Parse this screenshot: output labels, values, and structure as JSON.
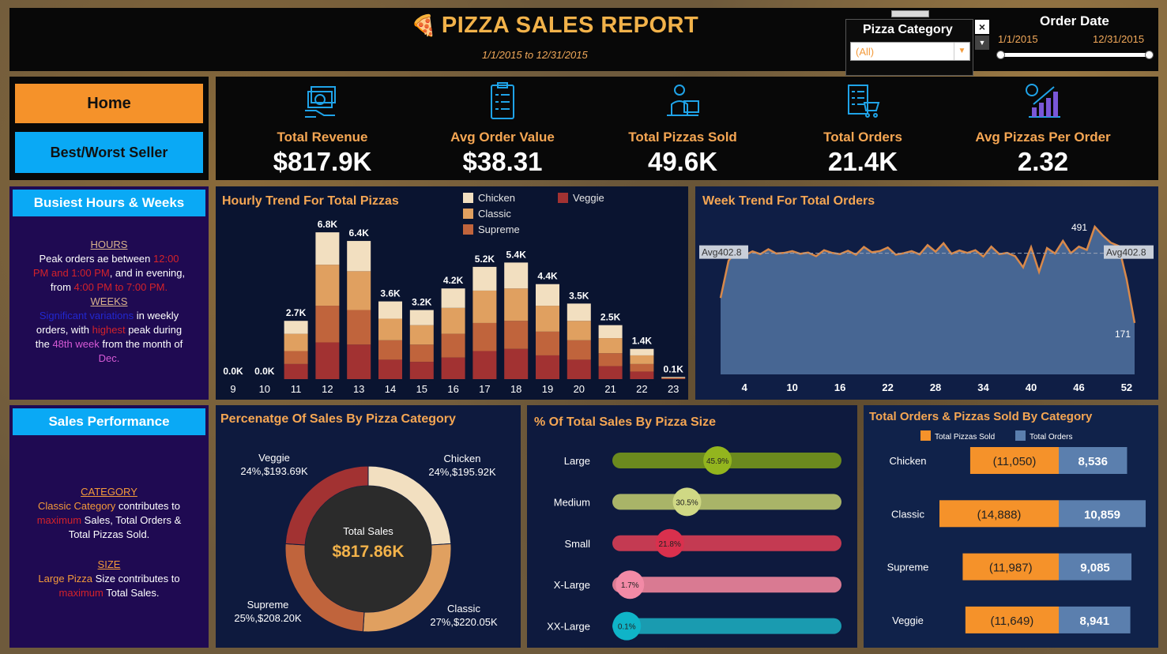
{
  "header": {
    "title": "PIZZA SALES REPORT",
    "subtitle": "1/1/2015 to 12/31/2015",
    "pizza_category_label": "Pizza Category",
    "pizza_category_value": "(All)",
    "order_date_label": "Order Date",
    "order_date_from": "1/1/2015",
    "order_date_to": "12/31/2015"
  },
  "nav": {
    "home": "Home",
    "best_worst": "Best/Worst Seller"
  },
  "kpis": [
    {
      "label": "Total Revenue",
      "value": "$817.9K",
      "icon": "money-icon"
    },
    {
      "label": "Avg Order Value",
      "value": "$38.31",
      "icon": "clipboard-icon"
    },
    {
      "label": "Total Pizzas Sold",
      "value": "49.6K",
      "icon": "delivery-icon"
    },
    {
      "label": "Total Orders",
      "value": "21.4K",
      "icon": "cart-icon"
    },
    {
      "label": "Avg Pizzas Per Order",
      "value": "2.32",
      "icon": "growth-chart-icon"
    }
  ],
  "busiest": {
    "heading": "Busiest Hours & Weeks",
    "hours_title": "HOURS",
    "hours_text_1": "Peak orders ae between ",
    "hours_text_2": "12:00 PM and 1:00 PM",
    "hours_text_3": ", and in evening, from ",
    "hours_text_4": "4:00 PM to 7:00 PM.",
    "weeks_title": "WEEKS",
    "weeks_text_1": "Significant variations",
    "weeks_text_2": " in weekly orders, with ",
    "weeks_text_3": "highest",
    "weeks_text_4": " peak during the ",
    "weeks_text_5": "48th week",
    "weeks_text_6": " from the month of ",
    "weeks_text_7": "Dec."
  },
  "sales_perf": {
    "heading": "Sales Performance",
    "cat_title": "CATEGORY",
    "cat_text_1": "Classic Category",
    "cat_text_2": " contributes to ",
    "cat_text_3": "maximum",
    "cat_text_4": " Sales, Total Orders & Total Pizzas Sold.",
    "size_title": "SIZE",
    "size_text_1": "Large Pizza",
    "size_text_2": " Size contributes to ",
    "size_text_3": "maximum",
    "size_text_4": " Total Sales."
  },
  "chart_titles": {
    "hourly": "Hourly Trend For Total Pizzas",
    "weekly": "Week Trend For Total Orders",
    "donut": "Percenatge Of Sales By Pizza Category",
    "size": "% Of Total Sales By Pizza Size",
    "cat_bars": "Total Orders & Pizzas Sold By Category"
  },
  "colors": {
    "chicken": "#f2dfc0",
    "classic": "#e0a060",
    "supreme": "#c0643c",
    "veggie": "#a23232",
    "accent": "#f5a653",
    "button_home": "#f5922a",
    "button_blue": "#0aa9f5"
  },
  "chart_data": [
    {
      "type": "bar",
      "title": "Hourly Trend For Total Pizzas",
      "stacked": true,
      "categories": [
        "9",
        "10",
        "11",
        "12",
        "13",
        "14",
        "15",
        "16",
        "17",
        "18",
        "19",
        "20",
        "21",
        "22",
        "23"
      ],
      "totals": [
        "0.0K",
        "0.0K",
        "2.7K",
        "6.8K",
        "6.4K",
        "3.6K",
        "3.2K",
        "4.2K",
        "5.2K",
        "5.4K",
        "4.4K",
        "3.5K",
        "2.5K",
        "1.4K",
        "0.1K"
      ],
      "legend": [
        "Chicken",
        "Classic",
        "Supreme",
        "Veggie"
      ],
      "series": [
        {
          "name": "Chicken",
          "values": [
            0,
            0,
            0.6,
            1.5,
            1.4,
            0.8,
            0.7,
            0.9,
            1.1,
            1.2,
            1.0,
            0.8,
            0.6,
            0.3,
            0.03
          ]
        },
        {
          "name": "Classic",
          "values": [
            0,
            0,
            0.8,
            1.9,
            1.8,
            1.0,
            0.9,
            1.2,
            1.5,
            1.5,
            1.2,
            0.9,
            0.7,
            0.4,
            0.03
          ]
        },
        {
          "name": "Supreme",
          "values": [
            0,
            0,
            0.6,
            1.7,
            1.6,
            0.9,
            0.8,
            1.1,
            1.3,
            1.3,
            1.1,
            0.9,
            0.6,
            0.35,
            0.02
          ]
        },
        {
          "name": "Veggie",
          "values": [
            0,
            0,
            0.7,
            1.7,
            1.6,
            0.9,
            0.8,
            1.0,
            1.3,
            1.4,
            1.1,
            0.9,
            0.6,
            0.35,
            0.02
          ]
        }
      ],
      "ylim": [
        0,
        7.5
      ]
    },
    {
      "type": "area",
      "title": "Week Trend For Total Orders",
      "x_ticks": [
        "4",
        "10",
        "16",
        "22",
        "28",
        "34",
        "40",
        "46",
        "52"
      ],
      "average_label": "Avg402.8",
      "average": 402.8,
      "max_label": "491",
      "min_label": "171",
      "x": [
        1,
        2,
        3,
        4,
        5,
        6,
        7,
        8,
        9,
        10,
        11,
        12,
        13,
        14,
        15,
        16,
        17,
        18,
        19,
        20,
        21,
        22,
        23,
        24,
        25,
        26,
        27,
        28,
        29,
        30,
        31,
        32,
        33,
        34,
        35,
        36,
        37,
        38,
        39,
        40,
        41,
        42,
        43,
        44,
        45,
        46,
        47,
        48,
        49,
        50,
        51,
        52,
        53
      ],
      "values": [
        254,
        378,
        412,
        395,
        409,
        400,
        416,
        402,
        404,
        410,
        401,
        405,
        393,
        413,
        404,
        400,
        411,
        398,
        424,
        406,
        410,
        422,
        398,
        403,
        410,
        399,
        430,
        408,
        436,
        401,
        412,
        404,
        413,
        392,
        425,
        400,
        404,
        393,
        356,
        423,
        341,
        420,
        402,
        444,
        403,
        425,
        414,
        491,
        462,
        438,
        427,
        316,
        171
      ],
      "ylim": [
        0,
        520
      ]
    },
    {
      "type": "pie",
      "title": "Percenatge Of Sales By Pizza Category",
      "center_label": "Total Sales",
      "center_value": "$817.86K",
      "slices": [
        {
          "name": "Chicken",
          "percent": 24,
          "label": "Chicken",
          "value_label": "24%,$195.92K"
        },
        {
          "name": "Classic",
          "percent": 27,
          "label": "Classic",
          "value_label": "27%,$220.05K"
        },
        {
          "name": "Supreme",
          "percent": 25,
          "label": "Supreme",
          "value_label": "25%,$208.20K"
        },
        {
          "name": "Veggie",
          "percent": 24,
          "label": "Veggie",
          "value_label": "24%,$193.69K"
        }
      ]
    },
    {
      "type": "bar",
      "title": "% Of Total Sales By Pizza Size",
      "orientation": "horizontal",
      "categories": [
        "Large",
        "Medium",
        "Small",
        "X-Large",
        "XX-Large"
      ],
      "values": [
        45.9,
        30.5,
        21.8,
        1.7,
        0.1
      ],
      "value_labels": [
        "45.9%",
        "30.5%",
        "21.8%",
        "1.7%",
        "0.1%"
      ],
      "colors": [
        "#6b8a1e",
        "#a9b468",
        "#c43a52",
        "#d97a92",
        "#1a9bb0"
      ],
      "dot_colors": [
        "#93b51e",
        "#cfd884",
        "#d9304d",
        "#f28aa6",
        "#0fb4c8"
      ]
    },
    {
      "type": "bar",
      "title": "Total Orders & Pizzas Sold By Category",
      "orientation": "horizontal",
      "legend": [
        "Total Pizzas Sold",
        "Total Orders"
      ],
      "categories": [
        "Chicken",
        "Classic",
        "Supreme",
        "Veggie"
      ],
      "series": [
        {
          "name": "Total Pizzas Sold",
          "values": [
            11050,
            14888,
            11987,
            11649
          ],
          "labels": [
            "(11,050)",
            "(14,888)",
            "(11,987)",
            "(11,649)"
          ]
        },
        {
          "name": "Total Orders",
          "values": [
            8536,
            10859,
            9085,
            8941
          ],
          "labels": [
            "8,536",
            "10,859",
            "9,085",
            "8,941"
          ]
        }
      ]
    }
  ]
}
